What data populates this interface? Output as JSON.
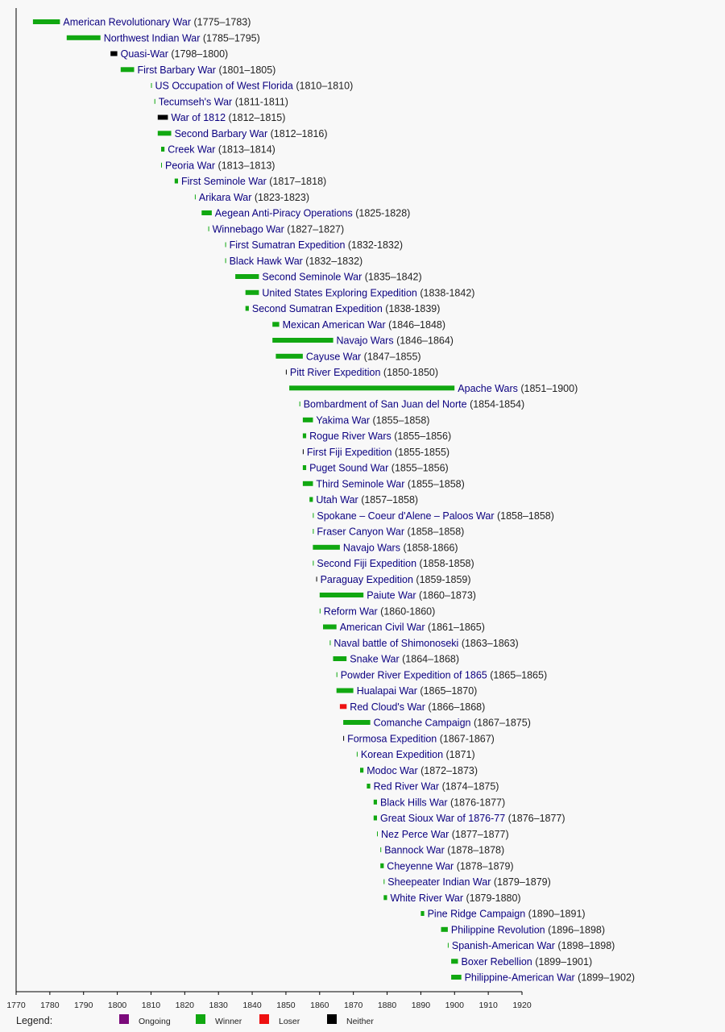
{
  "chart_data": {
    "type": "timeline",
    "title": "",
    "xlabel": "",
    "ylabel": "",
    "xlim": [
      1770,
      1920
    ],
    "x_ticks": [
      1770,
      1780,
      1790,
      1800,
      1810,
      1820,
      1830,
      1840,
      1850,
      1860,
      1870,
      1880,
      1890,
      1900,
      1910,
      1920
    ],
    "grid": false,
    "legend": {
      "title": "Legend:",
      "position": "bottom",
      "items": [
        {
          "key": "ongoing",
          "label": "Ongoing",
          "color": "#7b0a7b"
        },
        {
          "key": "winner",
          "label": "Winner",
          "color": "#11a811"
        },
        {
          "key": "loser",
          "label": "Loser",
          "color": "#ee1111"
        },
        {
          "key": "neither",
          "label": "Neither",
          "color": "#000000"
        }
      ]
    },
    "events": [
      {
        "name": "American Revolutionary War",
        "dates": "(1775–1783)",
        "start": 1775,
        "end": 1783,
        "outcome": "winner"
      },
      {
        "name": "Northwest Indian War",
        "dates": "(1785–1795)",
        "start": 1785,
        "end": 1795,
        "outcome": "winner"
      },
      {
        "name": "Quasi-War",
        "dates": "(1798–1800)",
        "start": 1798,
        "end": 1800,
        "outcome": "neither"
      },
      {
        "name": "First Barbary War",
        "dates": "(1801–1805)",
        "start": 1801,
        "end": 1805,
        "outcome": "winner"
      },
      {
        "name": "US Occupation of West Florida",
        "dates": "(1810–1810)",
        "start": 1810,
        "end": 1810,
        "outcome": "winner"
      },
      {
        "name": "Tecumseh's War",
        "dates": "(1811-1811)",
        "start": 1811,
        "end": 1811,
        "outcome": "winner"
      },
      {
        "name": "War of 1812",
        "dates": "(1812–1815)",
        "start": 1812,
        "end": 1815,
        "outcome": "neither"
      },
      {
        "name": "Second Barbary War",
        "dates": "(1812–1816)",
        "start": 1812,
        "end": 1816,
        "outcome": "winner"
      },
      {
        "name": "Creek War",
        "dates": "(1813–1814)",
        "start": 1813,
        "end": 1814,
        "outcome": "winner"
      },
      {
        "name": "Peoria War",
        "dates": "(1813–1813)",
        "start": 1813,
        "end": 1813,
        "outcome": "winner"
      },
      {
        "name": "First Seminole War",
        "dates": "(1817–1818)",
        "start": 1817,
        "end": 1818,
        "outcome": "winner"
      },
      {
        "name": "Arikara War",
        "dates": "(1823-1823)",
        "start": 1823,
        "end": 1823,
        "outcome": "winner"
      },
      {
        "name": "Aegean Anti-Piracy Operations",
        "dates": "(1825-1828)",
        "start": 1825,
        "end": 1828,
        "outcome": "winner"
      },
      {
        "name": "Winnebago War",
        "dates": "(1827–1827)",
        "start": 1827,
        "end": 1827,
        "outcome": "winner"
      },
      {
        "name": "First Sumatran Expedition",
        "dates": "(1832-1832)",
        "start": 1832,
        "end": 1832,
        "outcome": "winner"
      },
      {
        "name": "Black Hawk War",
        "dates": "(1832–1832)",
        "start": 1832,
        "end": 1832,
        "outcome": "winner"
      },
      {
        "name": "Second Seminole War",
        "dates": "(1835–1842)",
        "start": 1835,
        "end": 1842,
        "outcome": "winner"
      },
      {
        "name": "United States Exploring Expedition",
        "dates": "(1838-1842)",
        "start": 1838,
        "end": 1842,
        "outcome": "winner"
      },
      {
        "name": "Second Sumatran Expedition",
        "dates": "(1838-1839)",
        "start": 1838,
        "end": 1839,
        "outcome": "winner"
      },
      {
        "name": "Mexican American War",
        "dates": "(1846–1848)",
        "start": 1846,
        "end": 1848,
        "outcome": "winner"
      },
      {
        "name": "Navajo Wars",
        "dates": "(1846–1864)",
        "start": 1846,
        "end": 1864,
        "outcome": "winner"
      },
      {
        "name": "Cayuse War",
        "dates": "(1847–1855)",
        "start": 1847,
        "end": 1855,
        "outcome": "winner"
      },
      {
        "name": "Pitt River Expedition",
        "dates": "(1850-1850)",
        "start": 1850,
        "end": 1850,
        "outcome": "neither"
      },
      {
        "name": "Apache Wars",
        "dates": "(1851–1900)",
        "start": 1851,
        "end": 1900,
        "outcome": "winner"
      },
      {
        "name": "Bombardment of San Juan del Norte",
        "dates": "(1854-1854)",
        "start": 1854,
        "end": 1854,
        "outcome": "winner"
      },
      {
        "name": "Yakima War",
        "dates": "(1855–1858)",
        "start": 1855,
        "end": 1858,
        "outcome": "winner"
      },
      {
        "name": "Rogue River Wars",
        "dates": "(1855–1856)",
        "start": 1855,
        "end": 1856,
        "outcome": "winner"
      },
      {
        "name": "First Fiji Expedition",
        "dates": "(1855-1855)",
        "start": 1855,
        "end": 1855,
        "outcome": "neither"
      },
      {
        "name": "Puget Sound War",
        "dates": "(1855–1856)",
        "start": 1855,
        "end": 1856,
        "outcome": "winner"
      },
      {
        "name": "Third Seminole War",
        "dates": "(1855–1858)",
        "start": 1855,
        "end": 1858,
        "outcome": "winner"
      },
      {
        "name": "Utah War",
        "dates": "(1857–1858)",
        "start": 1857,
        "end": 1858,
        "outcome": "winner"
      },
      {
        "name": "Spokane – Coeur d'Alene – Paloos War",
        "dates": "(1858–1858)",
        "start": 1858,
        "end": 1858,
        "outcome": "winner"
      },
      {
        "name": "Fraser Canyon War",
        "dates": "(1858–1858)",
        "start": 1858,
        "end": 1858,
        "outcome": "winner"
      },
      {
        "name": "Navajo Wars",
        "dates": "(1858-1866)",
        "start": 1858,
        "end": 1866,
        "outcome": "winner"
      },
      {
        "name": "Second Fiji Expedition",
        "dates": "(1858-1858)",
        "start": 1858,
        "end": 1858,
        "outcome": "winner"
      },
      {
        "name": "Paraguay Expedition",
        "dates": "(1859-1859)",
        "start": 1859,
        "end": 1859,
        "outcome": "neither"
      },
      {
        "name": "Paiute War",
        "dates": "(1860–1873)",
        "start": 1860,
        "end": 1873,
        "outcome": "winner"
      },
      {
        "name": "Reform War",
        "dates": "(1860-1860)",
        "start": 1860,
        "end": 1860,
        "outcome": "winner"
      },
      {
        "name": "American Civil War",
        "dates": "(1861–1865)",
        "start": 1861,
        "end": 1865,
        "outcome": "winner"
      },
      {
        "name": "Naval battle of Shimonoseki",
        "dates": "(1863–1863)",
        "start": 1863,
        "end": 1863,
        "outcome": "winner"
      },
      {
        "name": "Snake War",
        "dates": "(1864–1868)",
        "start": 1864,
        "end": 1868,
        "outcome": "winner"
      },
      {
        "name": "Powder River Expedition of 1865",
        "dates": "(1865–1865)",
        "start": 1865,
        "end": 1865,
        "outcome": "winner"
      },
      {
        "name": "Hualapai War",
        "dates": "(1865–1870)",
        "start": 1865,
        "end": 1870,
        "outcome": "winner"
      },
      {
        "name": "Red Cloud's War",
        "dates": "(1866–1868)",
        "start": 1866,
        "end": 1868,
        "outcome": "loser"
      },
      {
        "name": "Comanche Campaign",
        "dates": "(1867–1875)",
        "start": 1867,
        "end": 1875,
        "outcome": "winner"
      },
      {
        "name": "Formosa Expedition",
        "dates": "(1867-1867)",
        "start": 1867,
        "end": 1867,
        "outcome": "neither"
      },
      {
        "name": "Korean Expedition",
        "dates": "(1871)",
        "start": 1871,
        "end": 1871,
        "outcome": "winner"
      },
      {
        "name": "Modoc War",
        "dates": "(1872–1873)",
        "start": 1872,
        "end": 1873,
        "outcome": "winner"
      },
      {
        "name": "Red River War",
        "dates": "(1874–1875)",
        "start": 1874,
        "end": 1875,
        "outcome": "winner"
      },
      {
        "name": "Black Hills War",
        "dates": "(1876-1877)",
        "start": 1876,
        "end": 1877,
        "outcome": "winner"
      },
      {
        "name": "Great Sioux War of 1876-77",
        "dates": "(1876–1877)",
        "start": 1876,
        "end": 1877,
        "outcome": "winner"
      },
      {
        "name": "Nez Perce War",
        "dates": "(1877–1877)",
        "start": 1877,
        "end": 1877,
        "outcome": "winner"
      },
      {
        "name": "Bannock War",
        "dates": "(1878–1878)",
        "start": 1878,
        "end": 1878,
        "outcome": "winner"
      },
      {
        "name": "Cheyenne War",
        "dates": "(1878–1879)",
        "start": 1878,
        "end": 1879,
        "outcome": "winner"
      },
      {
        "name": "Sheepeater Indian War",
        "dates": "(1879–1879)",
        "start": 1879,
        "end": 1879,
        "outcome": "winner"
      },
      {
        "name": "White River War",
        "dates": "(1879-1880)",
        "start": 1879,
        "end": 1880,
        "outcome": "winner"
      },
      {
        "name": "Pine Ridge Campaign",
        "dates": "(1890–1891)",
        "start": 1890,
        "end": 1891,
        "outcome": "winner"
      },
      {
        "name": "Philippine Revolution",
        "dates": "(1896–1898)",
        "start": 1896,
        "end": 1898,
        "outcome": "winner"
      },
      {
        "name": "Spanish-American War",
        "dates": "(1898–1898)",
        "start": 1898,
        "end": 1898,
        "outcome": "winner"
      },
      {
        "name": "Boxer Rebellion",
        "dates": "(1899–1901)",
        "start": 1899,
        "end": 1901,
        "outcome": "winner"
      },
      {
        "name": "Philippine-American War",
        "dates": "(1899–1902)",
        "start": 1899,
        "end": 1902,
        "outcome": "winner"
      }
    ]
  }
}
